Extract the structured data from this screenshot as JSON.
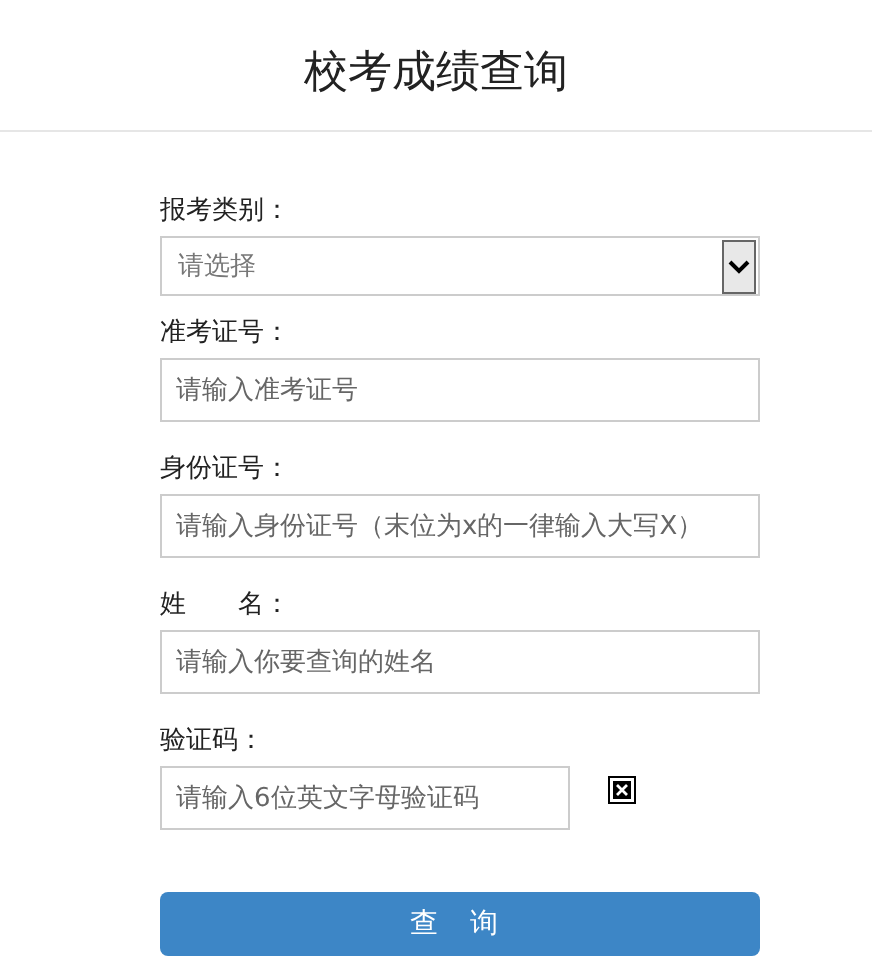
{
  "title": "校考成绩查询",
  "fields": [
    {
      "kind": "select",
      "label": "报考类别：",
      "placeholder": "请选择"
    },
    {
      "kind": "input",
      "label": "准考证号：",
      "placeholder": "请输入准考证号"
    },
    {
      "kind": "input",
      "label": "身份证号：",
      "placeholder": "请输入身份证号（末位为x的一律输入大写X）"
    },
    {
      "kind": "input",
      "label": "姓　　名：",
      "placeholder": "请输入你要查询的姓名"
    },
    {
      "kind": "captcha",
      "label": "验证码：",
      "placeholder": "请输入6位英文字母验证码"
    }
  ],
  "submit": "查 询"
}
